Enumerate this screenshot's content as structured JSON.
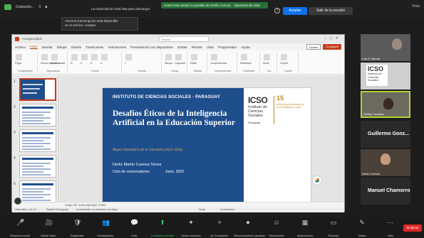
{
  "zoom_top": {
    "left_items": [
      "Grabando...",
      "II",
      "■"
    ],
    "banner": "Usted está viendo la pantalla de Derlis Cuenca",
    "view_options": "Opciones de vista",
    "notice": "La transcripción está lista para descargar",
    "accept_label": "Aceptar",
    "leave_label": "Salir de la reunión",
    "right_label": "Vista"
  },
  "tooltip": {
    "line1": "Ahora la transcripción está disponible",
    "line2": "en el archivo. Aceptar"
  },
  "ppt": {
    "title_left": "Autoguardado",
    "search_placeholder": "Buscar",
    "menu": [
      "Archivo",
      "Inicio",
      "Insertar",
      "Dibujar",
      "Diseño",
      "Transiciones",
      "Animaciones",
      "Presentación con diapositivas",
      "Grabar",
      "Revisar",
      "Vista",
      "Programador",
      "Ayuda"
    ],
    "active_menu_index": 1,
    "grab_label": "Grabar",
    "share_label": "Compartir",
    "ribbon_groups": [
      {
        "label": "Portapapeles",
        "items": [
          "Pegar"
        ]
      },
      {
        "label": "Diapositivas",
        "items": [
          "Nueva diapositiva",
          "Volver a usar"
        ]
      },
      {
        "label": "Fuente",
        "items": [
          "N",
          "K",
          "S",
          "A"
        ]
      },
      {
        "label": "Párrafo",
        "items": [
          "≡"
        ]
      },
      {
        "label": "Dibujo",
        "items": [
          "Dibujar",
          "Organizar"
        ]
      },
      {
        "label": "Edición",
        "items": [
          "Editar"
        ]
      },
      {
        "label": "Complementos",
        "items": [
          "Complementos"
        ]
      },
      {
        "label": "Diseñador",
        "items": [
          "Diseñador"
        ]
      },
      {
        "label": "Voz",
        "items": [
          "Dictar"
        ]
      },
      {
        "label": "Copilot",
        "items": [
          "Copilot"
        ]
      }
    ],
    "thumb_numbers": [
      "1",
      "2",
      "3",
      "4",
      "5"
    ],
    "notes_hint": "Haga clic para agregar notas",
    "status_items": [
      "Diapositiva 1 de 16",
      "Español (Paraguay)",
      "Accesibilidad: es necesario investigar",
      "Notas",
      "Comentarios"
    ]
  },
  "slide": {
    "institute": "INSTITUTO DE CIENCIAS SOCIALES - PARAGUAY",
    "title": "Desafíos Éticos de la Inteligencia Artificial en la Educación Superior",
    "subtitle": "Mapeo Sistemático de la Literatura (2022–2024)",
    "author": "Derliz Martín Cuenca Torres",
    "cycle": "Ciclo de conversatorios",
    "date": "Junio, 2026",
    "logo_icso": "ICSO",
    "logo_inst": "Instituto de Ciencias Sociales",
    "logo_country": "Paraguay",
    "logo_15": "15",
    "logo_15_text": "años comprometidos con la investigación social"
  },
  "participants": [
    {
      "name": "Luis E. Bernal",
      "type": "video"
    },
    {
      "name": "ICSO Instituto de Ciencias Sociales",
      "type": "logo"
    },
    {
      "name": "Shirley Carolina...",
      "type": "video-highlight"
    },
    {
      "name": "Guillermo Gonz...",
      "type": "name"
    },
    {
      "name": "Derliz Cuenca",
      "type": "video"
    },
    {
      "name": "Manuel Chamorro",
      "type": "name"
    }
  ],
  "zoom_bottom": {
    "items": [
      "Reactivar audio",
      "Iniciar video",
      "Seguridad",
      "Participantes",
      "Chat",
      "Compartir pantalla",
      "Iniciar resumen",
      "AI Companion",
      "Reconocimiento grabado",
      "Reacciones",
      "Aplicaciones",
      "Pizarras",
      "Notas",
      "Más"
    ],
    "share_index": 5,
    "leave_label": "Finalizar"
  }
}
